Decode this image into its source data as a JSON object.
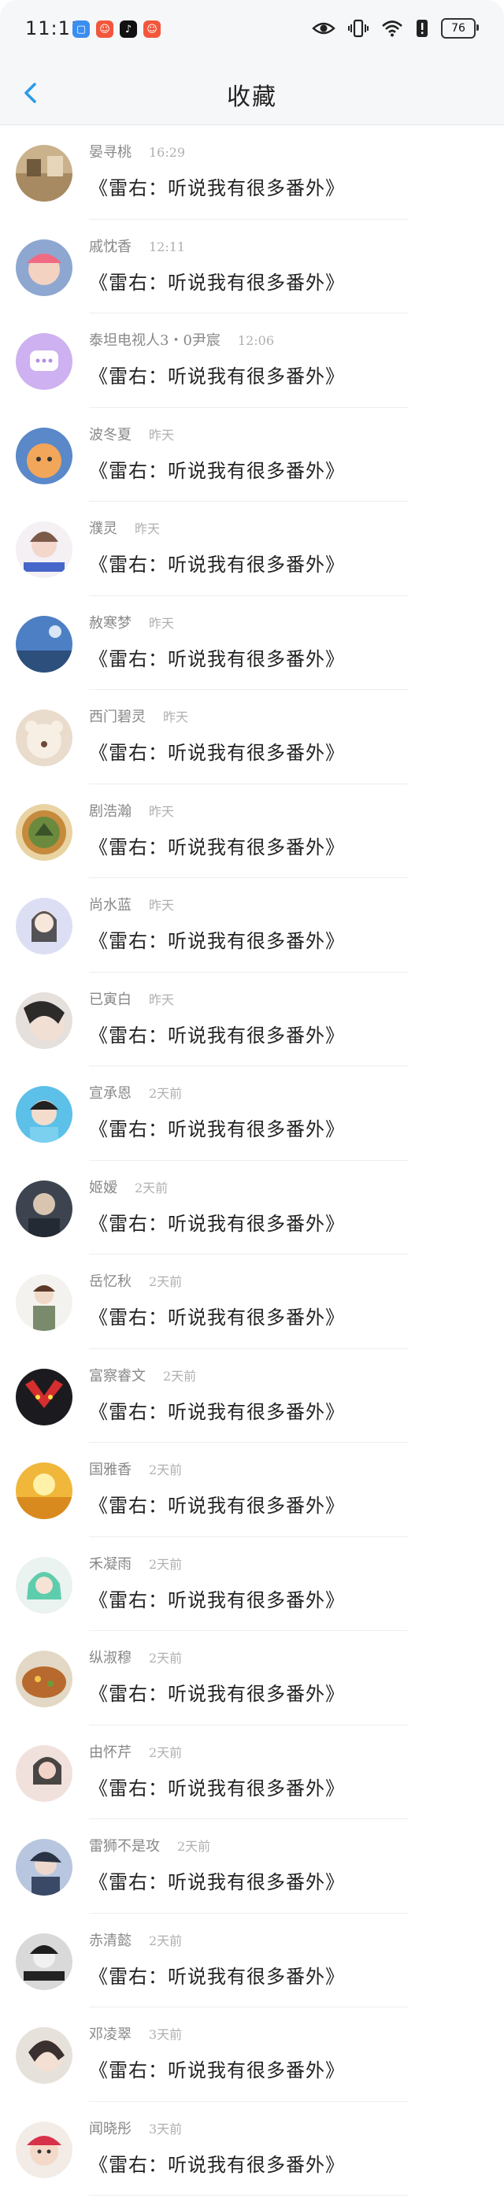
{
  "status_bar": {
    "time": "11:11",
    "battery": "76",
    "app_icons": [
      "app-a-icon",
      "app-b-icon",
      "tiktok-icon",
      "app-c-icon"
    ],
    "icons": [
      "eye-icon",
      "vibrate-icon",
      "wifi-icon",
      "alert-icon",
      "battery-icon"
    ]
  },
  "header": {
    "title": "收藏",
    "back_icon": "chevron-left-icon"
  },
  "accent_color": "#2b9be8",
  "items": [
    {
      "name": "晏寻桃",
      "time": "16:29",
      "message": "《雷右：听说我有很多番外》"
    },
    {
      "name": "戚忱香",
      "time": "12:11",
      "message": "《雷右：听说我有很多番外》"
    },
    {
      "name": "泰坦电视人3・0尹宸",
      "time": "12:06",
      "message": "《雷右：听说我有很多番外》"
    },
    {
      "name": "波冬夏",
      "time": "昨天",
      "message": "《雷右：听说我有很多番外》"
    },
    {
      "name": "濮灵",
      "time": "昨天",
      "message": "《雷右：听说我有很多番外》"
    },
    {
      "name": "赦寒梦",
      "time": "昨天",
      "message": "《雷右：听说我有很多番外》"
    },
    {
      "name": "西门碧灵",
      "time": "昨天",
      "message": "《雷右：听说我有很多番外》"
    },
    {
      "name": "剧浩瀚",
      "time": "昨天",
      "message": "《雷右：听说我有很多番外》"
    },
    {
      "name": "尚水蓝",
      "time": "昨天",
      "message": "《雷右：听说我有很多番外》"
    },
    {
      "name": "已寅白",
      "time": "昨天",
      "message": "《雷右：听说我有很多番外》"
    },
    {
      "name": "宣承恩",
      "time": "2天前",
      "message": "《雷右：听说我有很多番外》"
    },
    {
      "name": "姬嫒",
      "time": "2天前",
      "message": "《雷右：听说我有很多番外》"
    },
    {
      "name": "岳忆秋",
      "time": "2天前",
      "message": "《雷右：听说我有很多番外》"
    },
    {
      "name": "富察睿文",
      "time": "2天前",
      "message": "《雷右：听说我有很多番外》"
    },
    {
      "name": "国雅香",
      "time": "2天前",
      "message": "《雷右：听说我有很多番外》"
    },
    {
      "name": "禾凝雨",
      "time": "2天前",
      "message": "《雷右：听说我有很多番外》"
    },
    {
      "name": "纵淑穆",
      "time": "2天前",
      "message": "《雷右：听说我有很多番外》"
    },
    {
      "name": "由怀芹",
      "time": "2天前",
      "message": "《雷右：听说我有很多番外》"
    },
    {
      "name": "雷狮不是攻",
      "time": "2天前",
      "message": "《雷右：听说我有很多番外》"
    },
    {
      "name": "赤清懿",
      "time": "2天前",
      "message": "《雷右：听说我有很多番外》"
    },
    {
      "name": "邓凌翠",
      "time": "3天前",
      "message": "《雷右：听说我有很多番外》"
    },
    {
      "name": "闻晓彤",
      "time": "3天前",
      "message": "《雷右：听说我有很多番外》"
    }
  ]
}
